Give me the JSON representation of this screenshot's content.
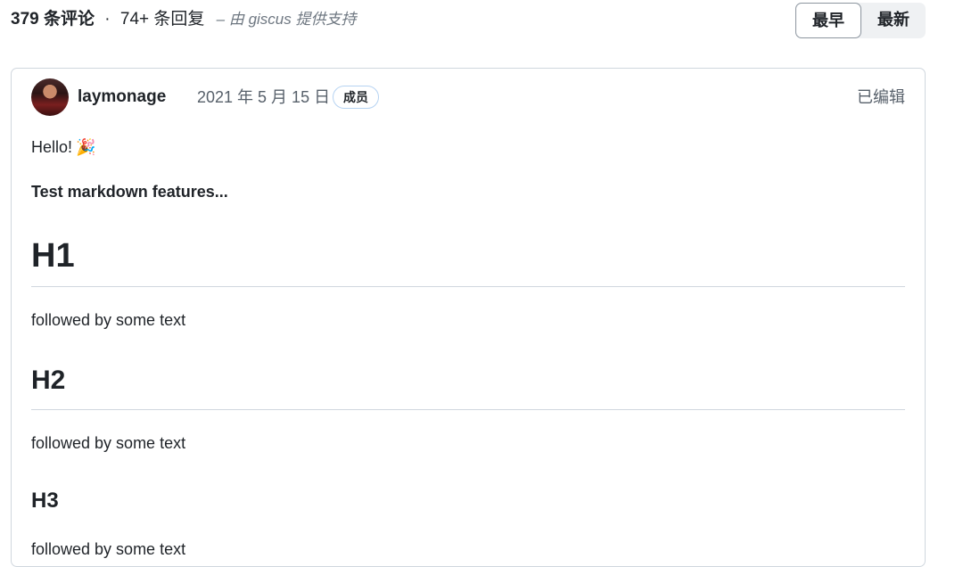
{
  "header": {
    "comment_count": "379 条评论",
    "separator": "·",
    "reply_count": "74+ 条回复",
    "powered_by": "– 由 giscus 提供支持"
  },
  "sort": {
    "oldest_label": "最早",
    "newest_label": "最新",
    "active": "oldest"
  },
  "comment": {
    "author": "laymonage",
    "date": "2021 年 5 月 15 日",
    "badge": "成员",
    "edited": "已编辑",
    "body": {
      "greeting": "Hello!",
      "emoji": "🎉",
      "intro": "Test markdown features...",
      "h1": "H1",
      "h1_text": "followed by some text",
      "h2": "H2",
      "h2_text": "followed by some text",
      "h3": "H3",
      "h3_text": "followed by some text"
    }
  }
}
